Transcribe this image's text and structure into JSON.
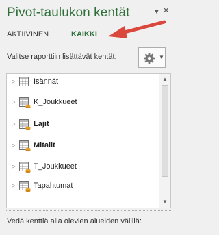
{
  "panel": {
    "title": "Pivot-taulukon kentät",
    "title_dropdown_icon": "dropdown-arrow-icon",
    "close_icon": "close-icon"
  },
  "tabs": [
    {
      "label": "AKTIIVINEN",
      "selected": false
    },
    {
      "label": "KAIKKI",
      "selected": true
    }
  ],
  "annotation": {
    "icon": "red-arrow-icon",
    "color": "#d9473d"
  },
  "instructions": "Valitse raporttiin lisättävät kentät:",
  "tools_button": {
    "icon": "gear-icon",
    "dropdown_icon": "dropdown-arrow-icon"
  },
  "fields": [
    {
      "label": "Isännät",
      "bold": false,
      "icon": "table-icon"
    },
    {
      "label": "K_Joukkueet",
      "bold": false,
      "icon": "table-icon"
    },
    {
      "label": "Lajit",
      "bold": true,
      "icon": "table-icon"
    },
    {
      "label": "Mitalit",
      "bold": true,
      "icon": "table-icon"
    },
    {
      "label": "T_Joukkueet",
      "bold": false,
      "icon": "table-icon"
    },
    {
      "label": "Tapahtumat",
      "bold": false,
      "icon": "table-icon"
    }
  ],
  "footer": {
    "label": "Vedä kenttiä alla olevien alueiden välillä:"
  },
  "colors": {
    "accent_green": "#2f6f3a",
    "arrow_red": "#d9473d"
  }
}
